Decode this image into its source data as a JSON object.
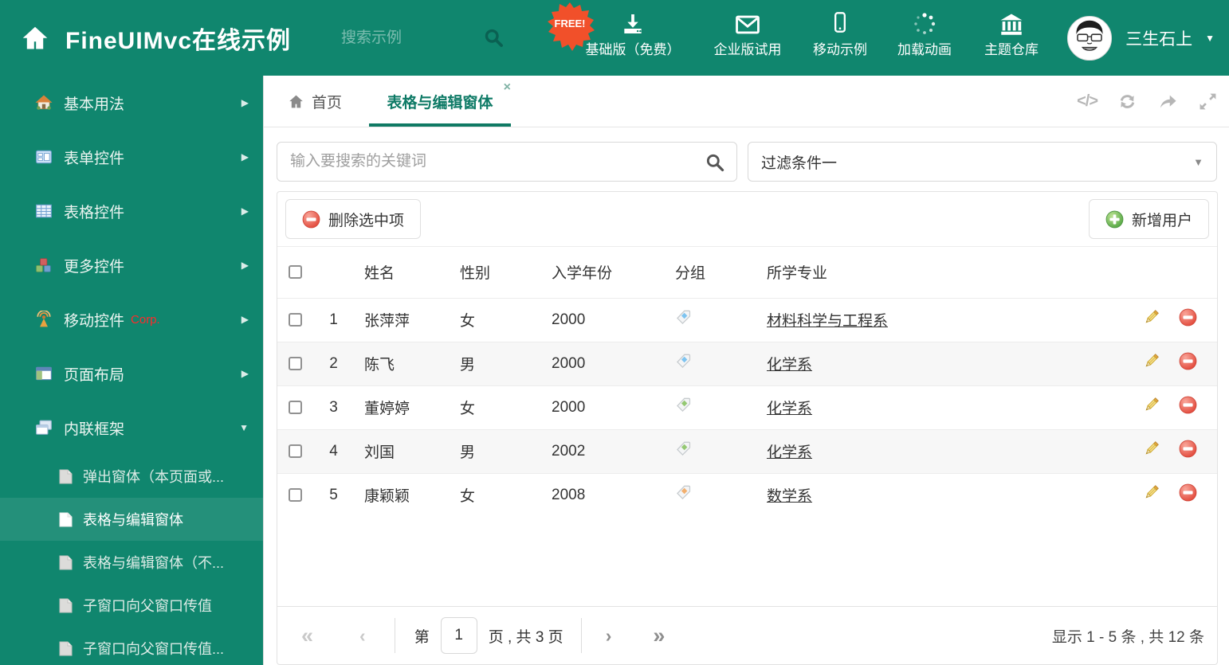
{
  "header": {
    "brand": "FineUIMvc在线示例",
    "search_placeholder": "搜索示例",
    "free_badge": "FREE!",
    "nav_items": [
      {
        "label": "基础版（免费）",
        "icon": "download-icon"
      },
      {
        "label": "企业版试用",
        "icon": "envelope-icon"
      },
      {
        "label": "移动示例",
        "icon": "mobile-icon"
      },
      {
        "label": "加载动画",
        "icon": "spinner-icon"
      },
      {
        "label": "主题仓库",
        "icon": "bank-icon"
      }
    ],
    "user": {
      "name": "三生石上"
    }
  },
  "sidebar": {
    "items": [
      {
        "label": "基本用法",
        "icon": "home-icon"
      },
      {
        "label": "表单控件",
        "icon": "form-icon"
      },
      {
        "label": "表格控件",
        "icon": "table-icon"
      },
      {
        "label": "更多控件",
        "icon": "cubes-icon"
      },
      {
        "label": "移动控件",
        "badge": "Corp.",
        "icon": "antenna-icon"
      },
      {
        "label": "页面布局",
        "icon": "layout-icon"
      },
      {
        "label": "内联框架",
        "icon": "frames-icon",
        "expanded": true
      }
    ],
    "subitems": [
      {
        "label": "弹出窗体（本页面或...",
        "active": false
      },
      {
        "label": "表格与编辑窗体",
        "active": true
      },
      {
        "label": "表格与编辑窗体（不...",
        "active": false
      },
      {
        "label": "子窗口向父窗口传值",
        "active": false
      },
      {
        "label": "子窗口向父窗口传值...",
        "active": false
      }
    ]
  },
  "tabs": {
    "home_label": "首页",
    "active_label": "表格与编辑窗体"
  },
  "filters": {
    "search_placeholder": "输入要搜索的关键词",
    "dropdown_value": "过滤条件一"
  },
  "toolbar": {
    "delete_label": "删除选中项",
    "add_label": "新增用户"
  },
  "table": {
    "columns": [
      "姓名",
      "性别",
      "入学年份",
      "分组",
      "所学专业"
    ],
    "rows": [
      {
        "num": "1",
        "name": "张萍萍",
        "gender": "女",
        "year": "2000",
        "tag_color": "#7EC4F0",
        "major": "材料科学与工程系"
      },
      {
        "num": "2",
        "name": "陈飞",
        "gender": "男",
        "year": "2000",
        "tag_color": "#7EC4F0",
        "major": "化学系"
      },
      {
        "num": "3",
        "name": "董婷婷",
        "gender": "女",
        "year": "2000",
        "tag_color": "#94C873",
        "major": "化学系"
      },
      {
        "num": "4",
        "name": "刘国",
        "gender": "男",
        "year": "2002",
        "tag_color": "#94C873",
        "major": "化学系"
      },
      {
        "num": "5",
        "name": "康颖颖",
        "gender": "女",
        "year": "2008",
        "tag_color": "#F2AF6E",
        "major": "数学系"
      }
    ]
  },
  "pagination": {
    "page_prefix": "第",
    "page_value": "1",
    "page_suffix": "页 , 共 3 页",
    "summary": "显示 1 - 5 条 , 共 12 条"
  },
  "icons": {
    "code": "</>",
    "close": "×",
    "caret_down": "▼",
    "arrow_right": "▶",
    "arrow_down": "▼",
    "pager_first": "«",
    "pager_prev": "‹",
    "pager_next": "›",
    "pager_last": "»"
  },
  "colors": {
    "accent": "#10866E",
    "sidebar_selected": "#24907A",
    "active_tab": "#0F7A64",
    "free_badge": "#F1502A",
    "corp_badge": "#FF2A2A"
  }
}
